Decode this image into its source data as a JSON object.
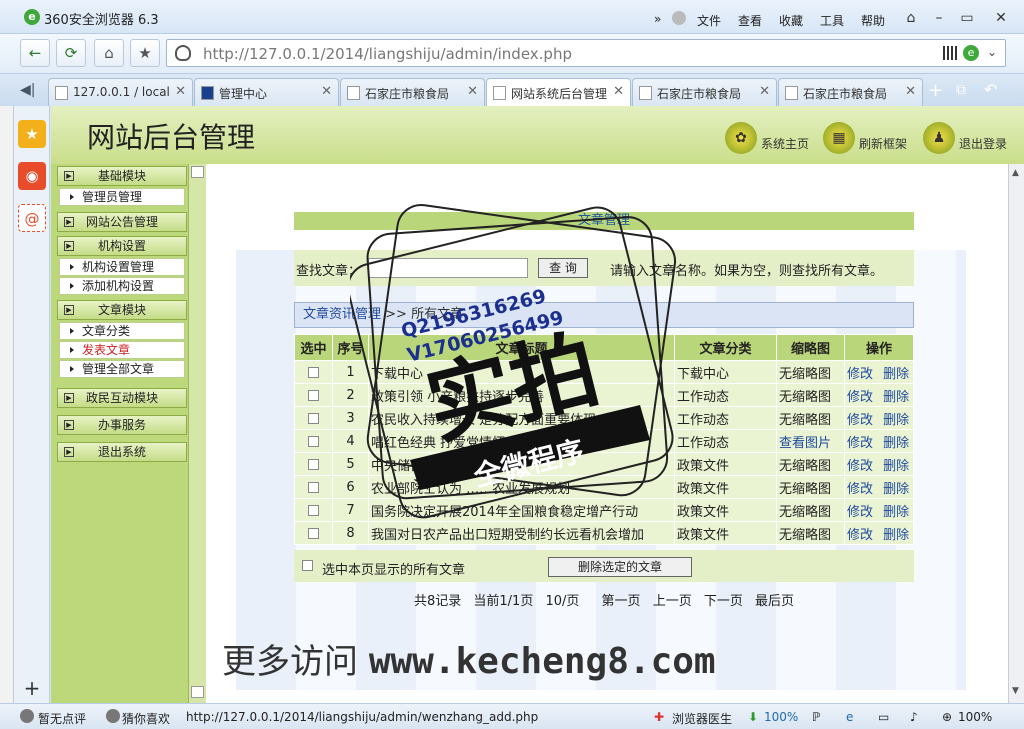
{
  "browser": {
    "title": "360安全浏览器 6.3",
    "menu": [
      "文件",
      "查看",
      "收藏",
      "工具",
      "帮助"
    ],
    "url": "http://127.0.0.1/2014/liangshiju/admin/index.php",
    "tabs": [
      {
        "label": "127.0.0.1 / local"
      },
      {
        "label": "管理中心"
      },
      {
        "label": "石家庄市粮食局"
      },
      {
        "label": "网站系统后台管理"
      },
      {
        "label": "石家庄市粮食局"
      },
      {
        "label": "石家庄市粮食局"
      }
    ],
    "status": {
      "comment": "暂无点评",
      "guess": "猜你喜欢",
      "link": "http://127.0.0.1/2014/liangshiju/admin/wenzhang_add.php",
      "doctor": "浏览器医生",
      "speed": "100%",
      "zoom": "100%"
    }
  },
  "header": {
    "title": "网站后台管理",
    "buttons": [
      {
        "label": "系统主页"
      },
      {
        "label": "刷新框架"
      },
      {
        "label": "退出登录"
      }
    ]
  },
  "nav": {
    "sections": [
      {
        "title": "基础模块",
        "items": [
          "管理员管理"
        ]
      },
      {
        "title": "网站公告管理",
        "items": []
      },
      {
        "title": "机构设置",
        "items": [
          "机构设置管理",
          "添加机构设置"
        ]
      },
      {
        "title": "文章模块",
        "items": [
          "文章分类",
          "发表文章",
          "管理全部文章"
        ]
      },
      {
        "title": "政民互动模块",
        "items": []
      },
      {
        "title": "办事服务",
        "items": []
      },
      {
        "title": "退出系统",
        "items": []
      }
    ]
  },
  "main": {
    "section_title": "文章管理",
    "search": {
      "label": "查找文章：",
      "button": "查 询",
      "hint": "请输入文章名称。如果为空，则查找所有文章。"
    },
    "breadcrumb": {
      "link": "文章资讯管理",
      "sep": ">>",
      "current": "所有文章"
    },
    "table": {
      "headers": [
        "选中",
        "序号",
        "文章标题",
        "文章分类",
        "缩略图",
        "操作"
      ],
      "rows": [
        {
          "n": "1",
          "title": "下载中心",
          "cat": "下载中心",
          "thumb": "无缩略图"
        },
        {
          "n": "2",
          "title": "政策引领 小产粮扶持逐步完善",
          "cat": "工作动态",
          "thumb": "无缩略图"
        },
        {
          "n": "3",
          "title": "农民收入持续增长 是分配方面重要体现",
          "cat": "工作动态",
          "thumb": "无缩略图"
        },
        {
          "n": "4",
          "title": "唱红色经典 抒爱党情怀",
          "cat": "工作动态",
          "thumb": "查看图片"
        },
        {
          "n": "5",
          "title": "中央储备粮管理",
          "cat": "政策文件",
          "thumb": "无缩略图"
        },
        {
          "n": "6",
          "title": "农业部院士认为 ……农业发展规划",
          "cat": "政策文件",
          "thumb": "无缩略图"
        },
        {
          "n": "7",
          "title": "国务院决定开展2014年全国粮食稳定增产行动",
          "cat": "政策文件",
          "thumb": "无缩略图"
        },
        {
          "n": "8",
          "title": "我国对日农产品出口短期受制约长远看机会增加",
          "cat": "政策文件",
          "thumb": "无缩略图"
        }
      ],
      "edit": "修改",
      "delete": "删除"
    },
    "select_all": "选中本页显示的所有文章",
    "delete_selected": "删除选定的文章",
    "pager": [
      "共8记录",
      "当前1/1页",
      "10/页",
      "第一页",
      "上一页",
      "下一页",
      "最后页"
    ]
  },
  "watermark": {
    "prefix": "更多访问",
    "site": "www.kecheng8.com",
    "stamp_qq": "Q2196316269",
    "stamp_v": "V17060256499",
    "stamp_main": "实拍",
    "stamp_sub": "全微程序"
  }
}
